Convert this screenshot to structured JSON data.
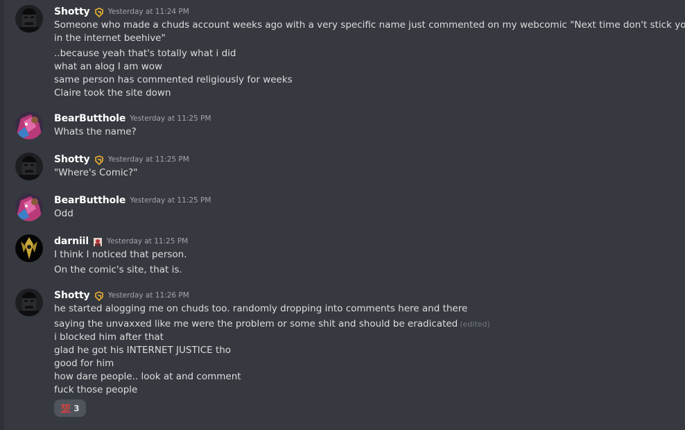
{
  "messages": [
    {
      "author": "Shotty",
      "timestamp": "Yesterday at 11:24 PM",
      "lines": [
        "Someone who made a chuds account weeks ago with a very specific name just commented on my webcomic \"Next time don't stick your dick",
        "in the internet beehive\"",
        "..because yeah that's totally what i did",
        "what an alog I am wow",
        "same person has commented religiously for weeks",
        "Claire took the site down"
      ]
    },
    {
      "author": "BearButthole",
      "timestamp": "Yesterday at 11:25 PM",
      "lines": [
        "Whats the name?"
      ]
    },
    {
      "author": "Shotty",
      "timestamp": "Yesterday at 11:25 PM",
      "lines": [
        "\"Where's Comic?\""
      ]
    },
    {
      "author": "BearButthole",
      "timestamp": "Yesterday at 11:25 PM",
      "lines": [
        "Odd"
      ]
    },
    {
      "author": "darniil",
      "timestamp": "Yesterday at 11:25 PM",
      "lines": [
        "I think I noticed that person.",
        "On the comic's site, that is."
      ]
    },
    {
      "author": "Shotty",
      "timestamp": "Yesterday at 11:26 PM",
      "lines": [
        "he started alogging me on chuds too. randomly dropping into comments here and there",
        "saying the unvaxxed like me were the problem or some shit and should be eradicated",
        "i blocked him after that",
        "glad he got his INTERNET JUSTICE tho",
        "good for him",
        "how dare people.. look at and comment",
        "fuck those people"
      ],
      "edited_label": "(edited)",
      "reaction": {
        "emoji": "💯",
        "count": "3"
      }
    }
  ],
  "colors": {
    "background": "#36393f",
    "username": "#ffffff",
    "message_text": "#dcddde",
    "timestamp": "#a3a6aa",
    "badge": "#f0b232"
  }
}
